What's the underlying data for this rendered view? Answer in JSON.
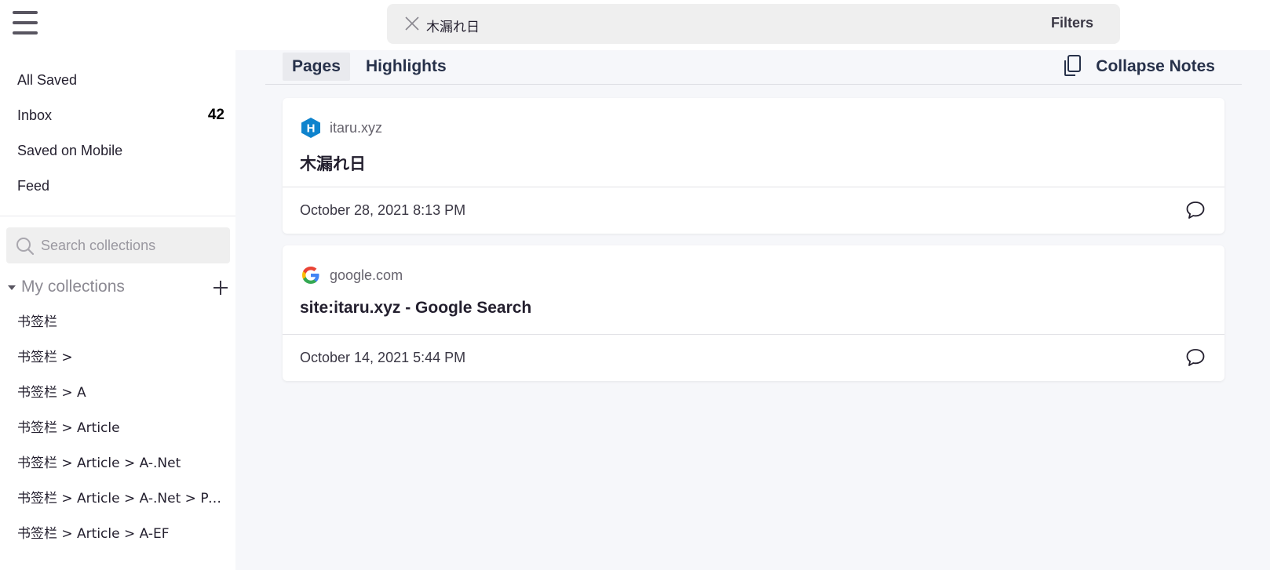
{
  "topbar": {
    "menu_icon": "hamburger-menu-icon",
    "search": {
      "query": "木漏れ日",
      "clear_icon": "close-icon"
    },
    "filters_label": "Filters"
  },
  "sidebar": {
    "nav": [
      {
        "label": "All Saved"
      },
      {
        "label": "Inbox",
        "count": "42"
      },
      {
        "label": "Saved on Mobile"
      },
      {
        "label": "Feed"
      }
    ],
    "collection_search": {
      "placeholder": "Search collections",
      "icon": "search-icon"
    },
    "collections": {
      "header": "My collections",
      "items": [
        "书签栏",
        "书签栏 >",
        "书签栏 > A",
        "书签栏 > Article",
        "书签栏 > Article > A-.Net",
        "书签栏 > Article > A-.Net > Po...",
        "书签栏 > Article > A-EF"
      ]
    }
  },
  "main": {
    "tabs": [
      {
        "label": "Pages",
        "active": true
      },
      {
        "label": "Highlights",
        "active": false
      }
    ],
    "collapse_notes_label": "Collapse Notes",
    "results": [
      {
        "domain": "itaru.xyz",
        "favicon": "hexo-h-icon",
        "title": "木漏れ日",
        "date": "October 28, 2021 8:13 PM"
      },
      {
        "domain": "google.com",
        "favicon": "google-g-icon",
        "title": "site:itaru.xyz - Google Search",
        "date": "October 14, 2021 5:44 PM"
      }
    ]
  },
  "colors": {
    "text_primary": "#231f2e",
    "tab_text": "#27314a",
    "main_background": "#f6f7fa",
    "search_background": "#efefef"
  }
}
